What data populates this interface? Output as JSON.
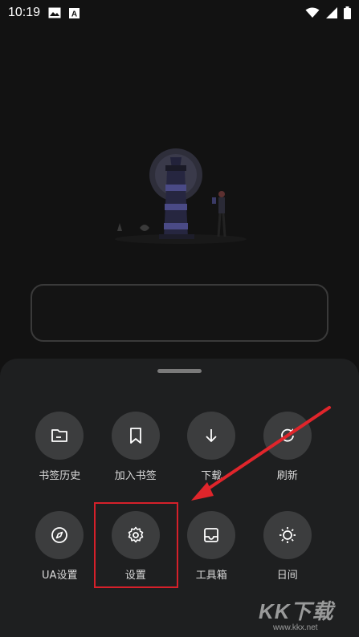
{
  "status_bar": {
    "time": "10:19",
    "icons": [
      "image-icon",
      "a-notification-icon",
      "wifi-icon",
      "signal-icon",
      "battery-icon"
    ]
  },
  "menu": {
    "items": [
      {
        "label": "书签历史",
        "icon": "folder-icon"
      },
      {
        "label": "加入书签",
        "icon": "bookmark-icon"
      },
      {
        "label": "下载",
        "icon": "download-icon"
      },
      {
        "label": "刷新",
        "icon": "refresh-icon"
      },
      {
        "label": "UA设置",
        "icon": "compass-icon"
      },
      {
        "label": "设置",
        "icon": "gear-icon"
      },
      {
        "label": "工具箱",
        "icon": "toolbox-icon"
      },
      {
        "label": "日间",
        "icon": "sun-icon"
      }
    ]
  },
  "annotation": {
    "highlight_color": "#d6202a",
    "arrow_color": "#e0252b"
  },
  "watermark": {
    "big": "KK下载",
    "small": "www.kkx.net"
  },
  "colors": {
    "background": "#121212",
    "sheet": "#1e1f20",
    "button": "#3c3d3e"
  }
}
